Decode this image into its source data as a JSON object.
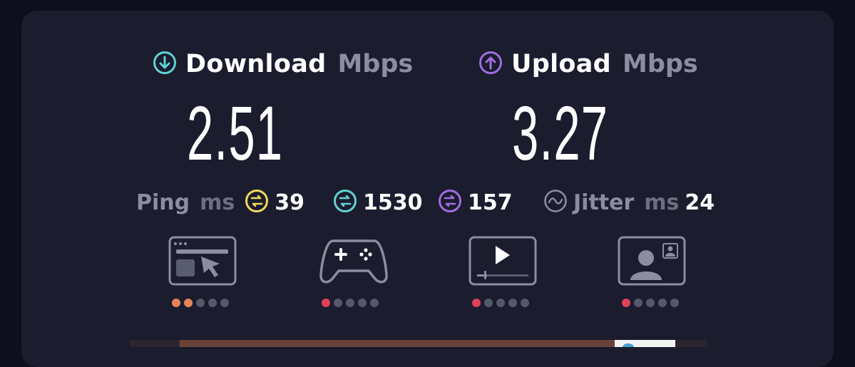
{
  "download": {
    "label": "Download",
    "unit": "Mbps",
    "value": "2.51"
  },
  "upload": {
    "label": "Upload",
    "unit": "Mbps",
    "value": "3.27"
  },
  "ping": {
    "label": "Ping",
    "unit": "ms",
    "idle": "39",
    "download": "1530",
    "upload": "157"
  },
  "jitter": {
    "label": "Jitter",
    "unit": "ms",
    "value": "24"
  },
  "colors": {
    "download_accent": "#5fd3d3",
    "upload_accent": "#a06ee0",
    "idle_accent": "#f2d85a",
    "rating_good": "#e8825a",
    "rating_low": "#e0405a",
    "rating_off": "#55586a"
  },
  "quality": [
    {
      "name": "web-browsing",
      "icon": "browser-cursor-icon",
      "filled": 2,
      "total": 5,
      "color": "#e8825a"
    },
    {
      "name": "gaming",
      "icon": "gamepad-icon",
      "filled": 1,
      "total": 5,
      "color": "#e0405a"
    },
    {
      "name": "video-streaming",
      "icon": "video-player-icon",
      "filled": 1,
      "total": 5,
      "color": "#e0405a"
    },
    {
      "name": "video-chat",
      "icon": "video-call-icon",
      "filled": 1,
      "total": 5,
      "color": "#e0405a"
    }
  ]
}
